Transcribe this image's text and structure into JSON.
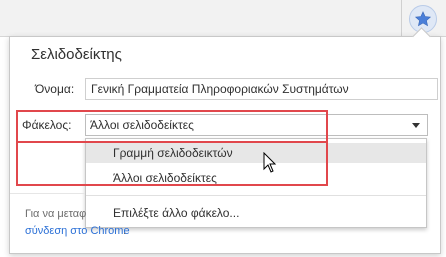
{
  "toolbar": {
    "star_icon": "star-icon",
    "star_color": "#4a7fd9"
  },
  "bookmark_bubble": {
    "title": "Σελιδοδείκτης",
    "name_label": "Όνομα:",
    "name_value": "Γενική Γραμματεία Πληροφοριακών Συστημάτων",
    "folder_label": "Φάκελος:",
    "folder_selected": "Άλλοι σελιδοδείκτες",
    "folder_options": [
      "Γραμμή σελιδοδεικτών",
      "Άλλοι σελιδοδείκτες",
      "Επιλέξτε άλλο φάκελο..."
    ],
    "sync_text": "Για να μεταφ",
    "sync_link": "σύνδεση στο Chrome",
    "sync_link_tail": ".",
    "highlight_color": "#e1474c"
  }
}
